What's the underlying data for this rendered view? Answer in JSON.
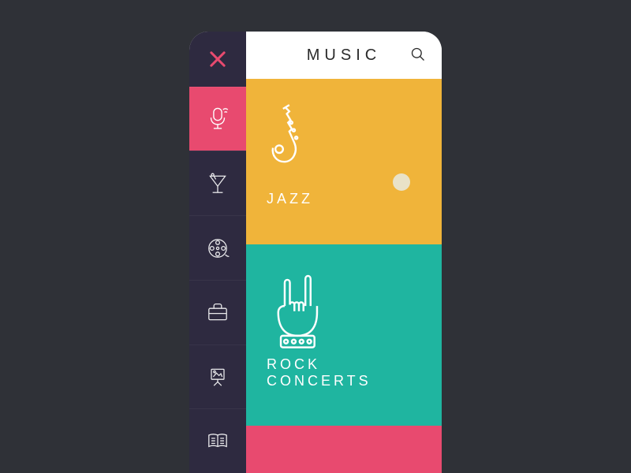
{
  "header": {
    "title": "MUSIC"
  },
  "sidebar": {
    "items": [
      {
        "name": "music",
        "active": true
      },
      {
        "name": "nightlife",
        "active": false
      },
      {
        "name": "cinema",
        "active": false
      },
      {
        "name": "business",
        "active": false
      },
      {
        "name": "art",
        "active": false
      },
      {
        "name": "reading",
        "active": false
      }
    ]
  },
  "categories": {
    "jazz": {
      "label": "JAZZ"
    },
    "rock": {
      "label": "ROCK CONCERTS"
    }
  },
  "colors": {
    "accent": "#e84a6f",
    "sidebar": "#2e2a40",
    "jazz": "#f0b43a",
    "rock": "#1fb5a0"
  }
}
